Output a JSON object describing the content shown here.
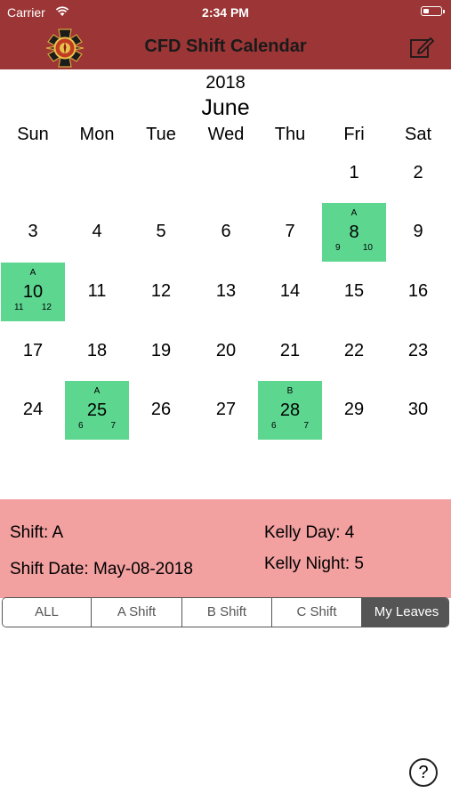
{
  "status_bar": {
    "carrier": "Carrier",
    "time": "2:34 PM"
  },
  "nav": {
    "title": "CFD Shift Calendar",
    "logo_icon": "fire-department-badge-icon",
    "edit_icon": "compose-icon"
  },
  "calendar": {
    "year": "2018",
    "month": "June",
    "weekdays": [
      "Sun",
      "Mon",
      "Tue",
      "Wed",
      "Thu",
      "Fri",
      "Sat"
    ],
    "weeks": [
      [
        {
          "day": ""
        },
        {
          "day": ""
        },
        {
          "day": ""
        },
        {
          "day": ""
        },
        {
          "day": ""
        },
        {
          "day": "1"
        },
        {
          "day": "2"
        }
      ],
      [
        {
          "day": "3"
        },
        {
          "day": "4"
        },
        {
          "day": "5"
        },
        {
          "day": "6"
        },
        {
          "day": "7"
        },
        {
          "day": "8",
          "shift": "A",
          "left": "9",
          "right": "10"
        },
        {
          "day": "9"
        }
      ],
      [
        {
          "day": "10",
          "shift": "A",
          "left": "11",
          "right": "12"
        },
        {
          "day": "11"
        },
        {
          "day": "12"
        },
        {
          "day": "13"
        },
        {
          "day": "14"
        },
        {
          "day": "15"
        },
        {
          "day": "16"
        }
      ],
      [
        {
          "day": "17"
        },
        {
          "day": "18"
        },
        {
          "day": "19"
        },
        {
          "day": "20"
        },
        {
          "day": "21"
        },
        {
          "day": "22"
        },
        {
          "day": "23"
        }
      ],
      [
        {
          "day": "24"
        },
        {
          "day": "25",
          "shift": "A",
          "left": "6",
          "right": "7"
        },
        {
          "day": "26"
        },
        {
          "day": "27"
        },
        {
          "day": "28",
          "shift": "B",
          "left": "6",
          "right": "7"
        },
        {
          "day": "29"
        },
        {
          "day": "30"
        }
      ]
    ],
    "highlight_color": "#5dd690"
  },
  "info": {
    "shift": "Shift: A",
    "shift_date": "Shift Date: May-08-2018",
    "kelly_day": "Kelly Day: 4",
    "kelly_night": "Kelly Night: 5",
    "background_color": "#f2a0a0"
  },
  "filters": {
    "segments": [
      "ALL",
      "A Shift",
      "B Shift",
      "C Shift",
      "My Leaves"
    ],
    "selected": "My Leaves"
  },
  "help": {
    "label": "?",
    "icon": "help-circle-icon"
  },
  "colors": {
    "header": "#9c3535"
  }
}
